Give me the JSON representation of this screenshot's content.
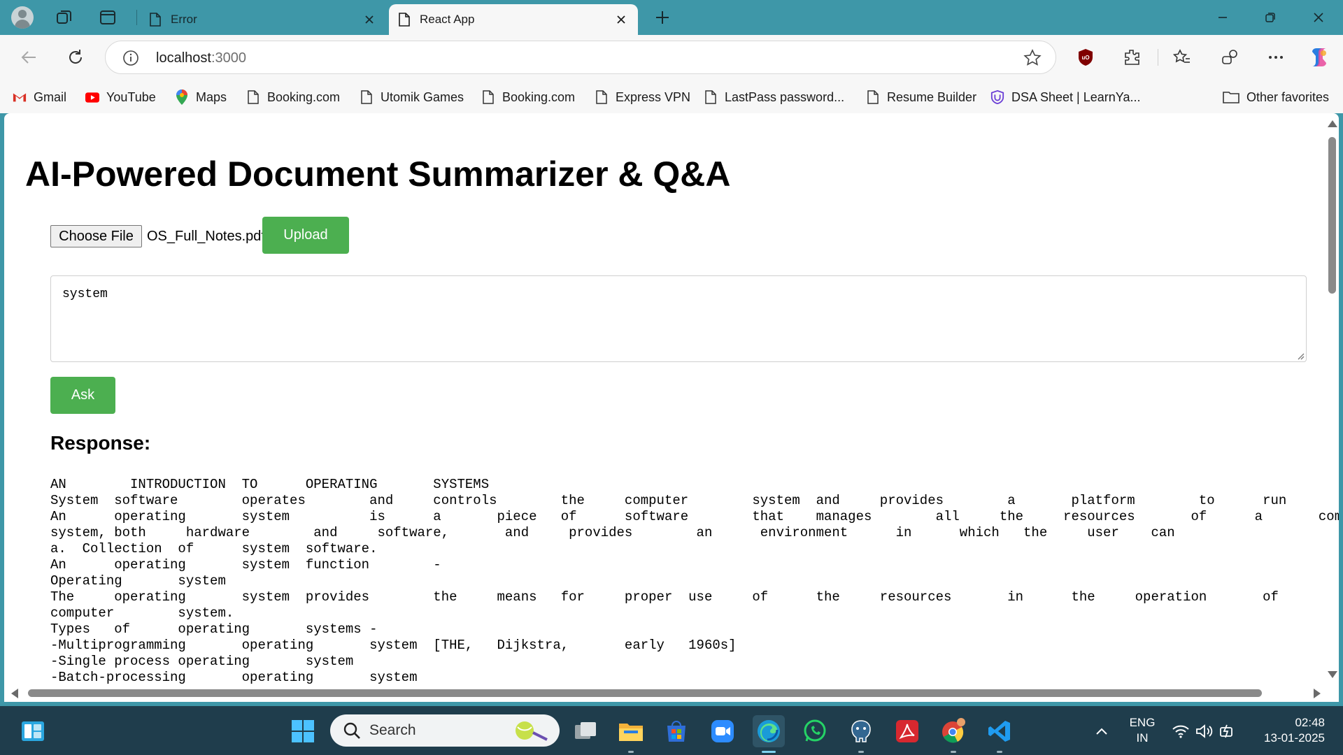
{
  "browser": {
    "tabs": [
      {
        "label": "Error",
        "active": false
      },
      {
        "label": "React App",
        "active": true
      }
    ],
    "address": {
      "host": "localhost",
      "port": ":3000"
    },
    "bookmarks": [
      {
        "label": "Gmail",
        "icon": "gmail-icon"
      },
      {
        "label": "YouTube",
        "icon": "youtube-icon"
      },
      {
        "label": "Maps",
        "icon": "maps-icon"
      },
      {
        "label": "Booking.com",
        "icon": "page-icon"
      },
      {
        "label": "Utomik Games",
        "icon": "page-icon"
      },
      {
        "label": "Booking.com",
        "icon": "page-icon"
      },
      {
        "label": "Express VPN",
        "icon": "page-icon"
      },
      {
        "label": "LastPass password...",
        "icon": "page-icon"
      },
      {
        "label": "Resume Builder",
        "icon": "page-icon"
      },
      {
        "label": "DSA Sheet | LearnYa...",
        "icon": "learnyard-icon"
      }
    ],
    "other_favorites": "Other favorites"
  },
  "app": {
    "title": "AI-Powered Document Summarizer & Q&A",
    "choose_file_label": "Choose File",
    "file_name": "OS_Full_Notes.pdf",
    "upload_label": "Upload",
    "question_value": "system",
    "ask_label": "Ask",
    "response_heading": "Response:",
    "response_text": "AN        INTRODUCTION  TO      OPERATING       SYSTEMS\nSystem  software        operates        and     controls        the     computer        system  and     provides        a       platform        to      run\nAn      operating       system          is      a       piece   of      software        that    manages        all     the     resources       of      a       computer\nsystem, both     hardware        and     software,       and     provides        an      environment      in      which   the     user    can\na.  Collection  of      system  software.\nAn      operating       system  function        -\nOperating       system\nThe     operating       system  provides        the     means   for     proper  use     of      the     resources       in      the     operation       of\ncomputer        system.\nTypes   of      operating       systems -\n-Multiprogramming       operating       system  [THE,   Dijkstra,       early   1960s]\n-Single process operating       system\n-Batch-processing       operating       system"
  },
  "taskbar": {
    "search_placeholder": "Search",
    "language_line1": "ENG",
    "language_line2": "IN",
    "time": "02:48",
    "date": "13-01-2025"
  },
  "colors": {
    "accent_green": "#4caf50",
    "titlebar_teal": "#3e97a8",
    "taskbar_dark": "#1f3d4c"
  }
}
